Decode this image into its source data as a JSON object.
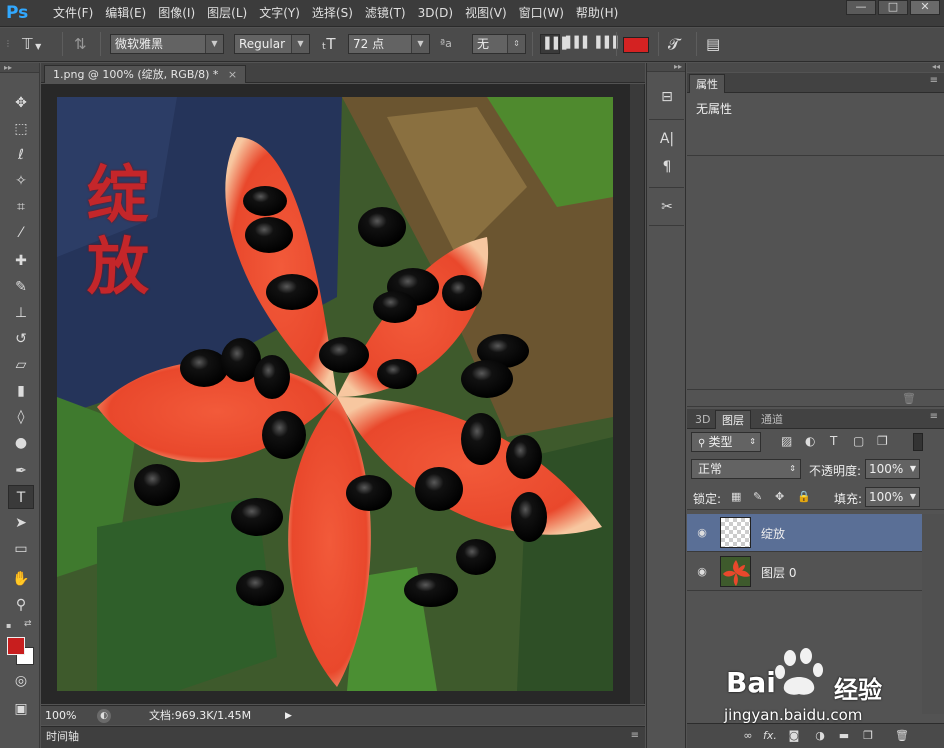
{
  "app": {
    "logo": "Ps"
  },
  "menu": [
    "文件(F)",
    "编辑(E)",
    "图像(I)",
    "图层(L)",
    "文字(Y)",
    "选择(S)",
    "滤镜(T)",
    "3D(D)",
    "视图(V)",
    "窗口(W)",
    "帮助(H)"
  ],
  "window_buttons": [
    "—",
    "□",
    "✕"
  ],
  "options": {
    "font_family": "微软雅黑",
    "font_style": "Regular",
    "font_size": "72 点",
    "aa_label": "ªa",
    "anti_alias": "无",
    "text_color": "#d42222"
  },
  "document": {
    "tab_title": "1.png @ 100% (绽放, RGB/8) *",
    "tab_close": "×",
    "canvas_text": "绽放",
    "zoom": "100%",
    "doc_info": "文档:969.3K/1.45M"
  },
  "timeline": {
    "label": "时间轴"
  },
  "panels": {
    "properties": {
      "tab": "属性",
      "empty": "无属性"
    },
    "layers_tabs": [
      "3D",
      "图层",
      "通道"
    ],
    "filter_kind": "类型",
    "blend_mode": "正常",
    "opacity_label": "不透明度:",
    "opacity": "100%",
    "lock_label": "锁定:",
    "fill_label": "填充:",
    "fill": "100%",
    "layers": [
      {
        "name": "绽放",
        "selected": true
      },
      {
        "name": "图层 0",
        "selected": false
      }
    ],
    "footer_fx": "fx."
  },
  "watermark": {
    "brand": "Bai",
    "brand_suffix": "经验",
    "url": "jingyan.baidu.com"
  },
  "colors": {
    "foreground": "#c81e1e",
    "background": "#ffffff"
  }
}
